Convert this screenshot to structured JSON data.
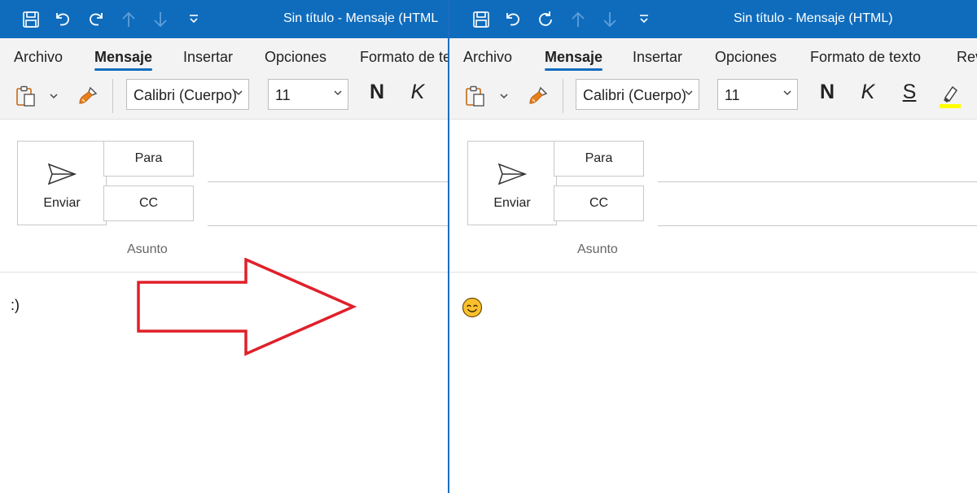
{
  "left": {
    "title": "Sin título  -  Mensaje (HTML",
    "tabs": [
      "Archivo",
      "Mensaje",
      "Insertar",
      "Opciones",
      "Formato de te"
    ],
    "font": "Calibri (Cuerpo)",
    "size": "11",
    "bold": "N",
    "italic": "K",
    "send": "Enviar",
    "to": "Para",
    "cc": "CC",
    "subject": "Asunto",
    "body": ":)"
  },
  "right": {
    "title": "Sin título  -  Mensaje (HTML)",
    "tabs": [
      "Archivo",
      "Mensaje",
      "Insertar",
      "Opciones",
      "Formato de texto",
      "Rev"
    ],
    "font": "Calibri (Cuerpo)",
    "size": "11",
    "bold": "N",
    "italic": "K",
    "strike": "S",
    "send": "Enviar",
    "to": "Para",
    "cc": "CC",
    "subject": "Asunto",
    "body_emoji": "smiling-face-emoji"
  },
  "colors": {
    "titlebar": "#0f6cbd",
    "accent_arrow": "#e0202a",
    "highlight": "#ffff00"
  },
  "icons": [
    "save-icon",
    "undo-icon",
    "redo-icon",
    "up-arrow-icon",
    "down-arrow-icon",
    "customize-icon",
    "paste-icon",
    "format-painter-icon",
    "send-icon",
    "highlighter-icon"
  ]
}
